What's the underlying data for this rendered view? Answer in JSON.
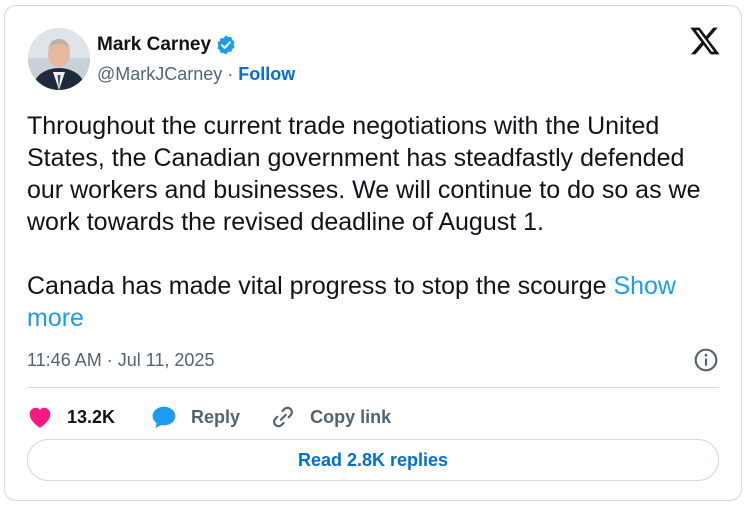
{
  "author": {
    "name": "Mark Carney",
    "handle": "@MarkJCarney",
    "separator": "·",
    "follow_label": "Follow",
    "verified": true
  },
  "tweet": {
    "paragraph1": "Throughout the current trade negotiations with the United States, the Canadian government has steadfastly defended our workers and businesses. We will continue to do so as we work towards the revised deadline of August 1.",
    "paragraph2": "Canada has made vital progress to stop the scourge ",
    "show_more": "Show more",
    "timestamp": "11:46 AM · Jul 11, 2025"
  },
  "actions": {
    "likes": "13.2K",
    "reply_label": "Reply",
    "copy_link_label": "Copy link"
  },
  "read_replies_label": "Read 2.8K replies",
  "colors": {
    "link": "#006fd6",
    "show_more": "#1d9bf0",
    "like": "#f91880",
    "reply": "#1d9bf0",
    "verified": "#1d9bf0",
    "border": "#cfd9de"
  },
  "icons": {
    "logo": "x-logo-icon",
    "verified": "verified-badge-icon",
    "info": "info-icon",
    "like": "heart-icon",
    "reply": "speech-bubble-icon",
    "copy": "link-icon"
  }
}
